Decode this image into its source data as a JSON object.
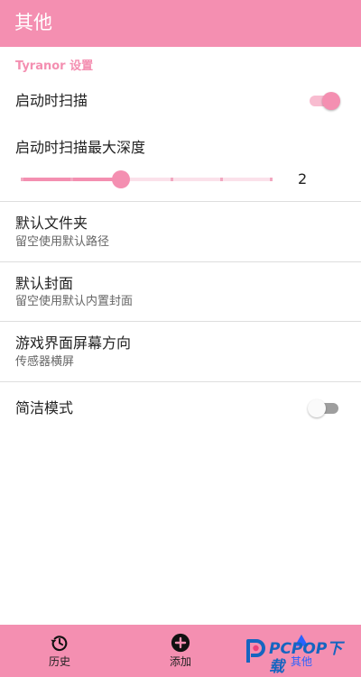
{
  "app_bar": {
    "title": "其他"
  },
  "settings": {
    "section_header": "Tyranor 设置",
    "scan_on_start": {
      "title": "启动时扫描",
      "enabled": true
    },
    "max_scan_depth": {
      "title": "启动时扫描最大深度",
      "value": "2",
      "min": 0,
      "max": 5,
      "current": 2
    },
    "default_folder": {
      "title": "默认文件夹",
      "summary": "留空使用默认路径"
    },
    "default_cover": {
      "title": "默认封面",
      "summary": "留空使用默认内置封面"
    },
    "screen_orientation": {
      "title": "游戏界面屏幕方向",
      "summary": "传感器横屏"
    },
    "simple_mode": {
      "title": "简洁模式",
      "enabled": false
    }
  },
  "bottom_nav": {
    "items": [
      {
        "label": "历史",
        "icon": "history-icon"
      },
      {
        "label": "添加",
        "icon": "add-circle-icon"
      },
      {
        "label": "其他",
        "icon": "more-icon",
        "active": true
      }
    ]
  },
  "watermark": {
    "text": "PCPOP下载"
  },
  "colors": {
    "accent": "#f48fb1",
    "accent_light": "#f8bcd0",
    "active_nav_label": "#2962ff"
  }
}
